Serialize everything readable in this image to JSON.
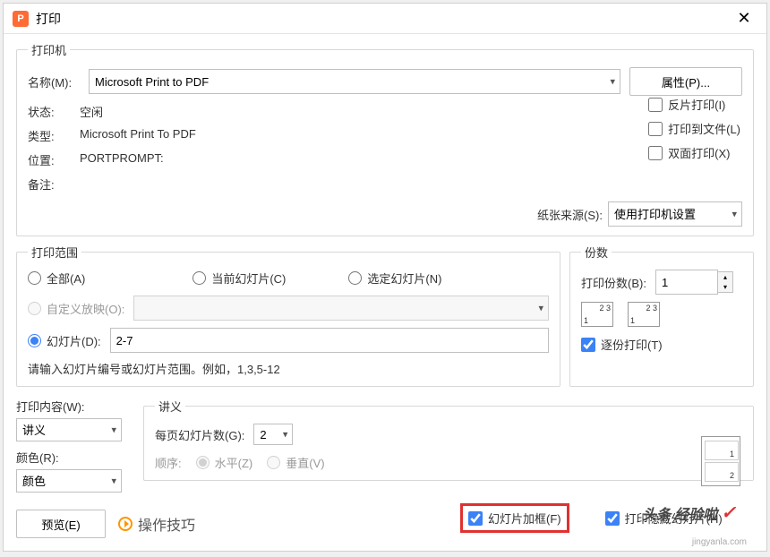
{
  "app_icon_letter": "P",
  "title": "打印",
  "printer": {
    "legend": "打印机",
    "name_label": "名称(M):",
    "name_value": "Microsoft Print to PDF",
    "properties_btn": "属性(P)...",
    "status_label": "状态:",
    "status_value": "空闲",
    "type_label": "类型:",
    "type_value": "Microsoft Print To PDF",
    "location_label": "位置:",
    "location_value": "PORTPROMPT:",
    "comment_label": "备注:",
    "comment_value": "",
    "reverse_print": "反片打印(I)",
    "print_to_file": "打印到文件(L)",
    "duplex_print": "双面打印(X)",
    "paper_source_label": "纸张来源(S):",
    "paper_source_value": "使用打印机设置"
  },
  "range": {
    "legend": "打印范围",
    "all": "全部(A)",
    "current": "当前幻灯片(C)",
    "selection": "选定幻灯片(N)",
    "custom": "自定义放映(O):",
    "slides": "幻灯片(D):",
    "slides_value": "2-7",
    "hint": "请输入幻灯片编号或幻灯片范围。例如，1,3,5-12"
  },
  "copies": {
    "legend": "份数",
    "label": "打印份数(B):",
    "value": "1",
    "collate": "逐份打印(T)"
  },
  "content": {
    "label": "打印内容(W):",
    "value": "讲义"
  },
  "color": {
    "label": "颜色(R):",
    "value": "颜色"
  },
  "handout": {
    "legend": "讲义",
    "per_page_label": "每页幻灯片数(G):",
    "per_page_value": "2",
    "order_label": "顺序:",
    "horizontal": "水平(Z)",
    "vertical": "垂直(V)",
    "frame_slides": "幻灯片加框(F)",
    "print_hidden": "打印隐藏幻灯片(H)"
  },
  "footer": {
    "preview_btn": "预览(E)",
    "tips": "操作技巧"
  },
  "watermark": {
    "brand1": "头条",
    "brand2": "经验啦",
    "url": "jingyanla.com"
  }
}
